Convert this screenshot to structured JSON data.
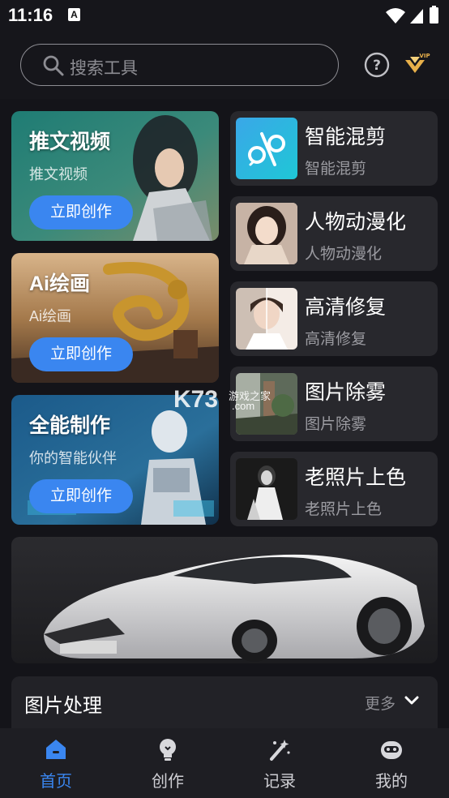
{
  "status_bar": {
    "time": "11:16",
    "notification_glyph": "A"
  },
  "search": {
    "placeholder": "搜索工具"
  },
  "header": {
    "vip_badge": "VIP"
  },
  "feature_cards": [
    {
      "title": "推文视频",
      "subtitle": "推文视频",
      "button": "立即创作"
    },
    {
      "title": "Ai绘画",
      "subtitle": "Ai绘画",
      "button": "立即创作"
    },
    {
      "title": "全能制作",
      "subtitle": "你的智能伙伴",
      "button": "立即创作"
    }
  ],
  "tools": [
    {
      "title": "智能混剪",
      "subtitle": "智能混剪"
    },
    {
      "title": "人物动漫化",
      "subtitle": "人物动漫化"
    },
    {
      "title": "高清修复",
      "subtitle": "高清修复"
    },
    {
      "title": "图片除雾",
      "subtitle": "图片除雾"
    },
    {
      "title": "老照片上色",
      "subtitle": "老照片上色"
    }
  ],
  "watermark": {
    "brand": "K73",
    "site": "游戏之家",
    "domain": ".com"
  },
  "section": {
    "title": "图片处理",
    "more": "更多"
  },
  "nav": [
    {
      "label": "首页",
      "active": true
    },
    {
      "label": "创作",
      "active": false
    },
    {
      "label": "记录",
      "active": false
    },
    {
      "label": "我的",
      "active": false
    }
  ],
  "colors": {
    "accent": "#3a86f0",
    "background": "#141419",
    "card": "#28282d",
    "vip_gold": "#e8b04a"
  }
}
